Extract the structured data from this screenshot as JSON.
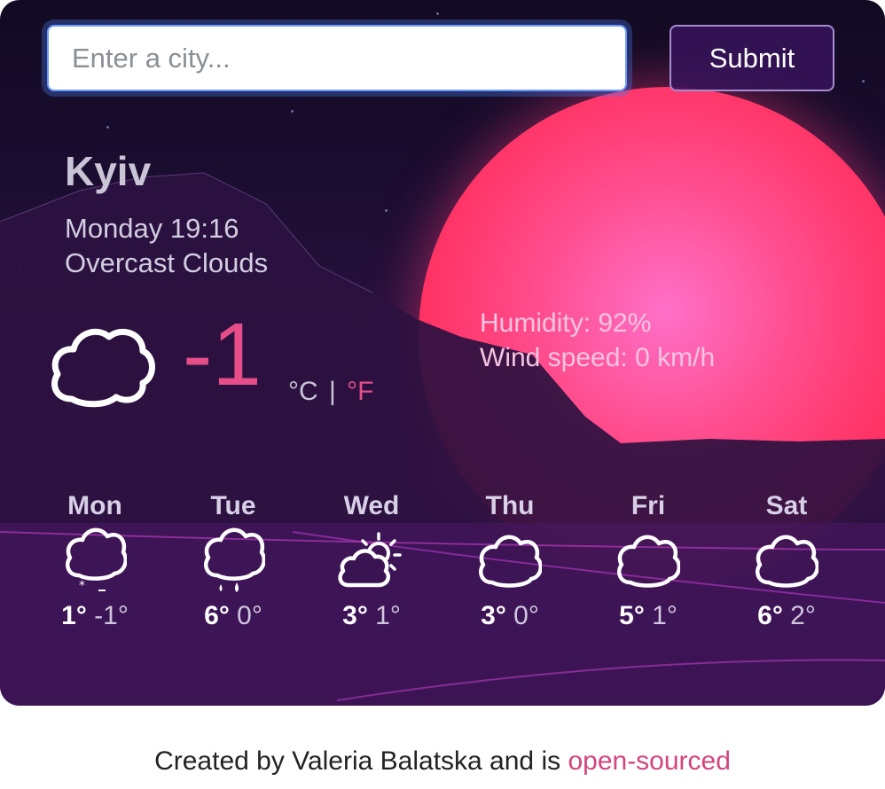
{
  "search": {
    "placeholder": "Enter a city...",
    "submit_label": "Submit"
  },
  "current": {
    "city": "Kyiv",
    "datetime": "Monday 19:16",
    "description": "Overcast Clouds",
    "icon": "cloud-icon",
    "temperature": "-1",
    "unit_c": "°C",
    "unit_sep": "|",
    "unit_f": "°F",
    "humidity": "Humidity: 92%",
    "wind": "Wind speed: 0 km/h"
  },
  "forecast": [
    {
      "day": "Mon",
      "icon": "snow-icon",
      "max": "1°",
      "min": "-1°"
    },
    {
      "day": "Tue",
      "icon": "rain-icon",
      "max": "6°",
      "min": "0°"
    },
    {
      "day": "Wed",
      "icon": "partly-sunny-icon",
      "max": "3°",
      "min": "1°"
    },
    {
      "day": "Thu",
      "icon": "cloud-icon",
      "max": "3°",
      "min": "0°"
    },
    {
      "day": "Fri",
      "icon": "cloud-icon",
      "max": "5°",
      "min": "1°"
    },
    {
      "day": "Sat",
      "icon": "cloud-icon",
      "max": "6°",
      "min": "2°"
    }
  ],
  "footer": {
    "text": "Created by Valeria Balatska and is",
    "link": "open-sourced"
  },
  "colors": {
    "accent": "#e64e8a",
    "sun": "#ff4d8e",
    "input_border": "#6a9bff"
  }
}
